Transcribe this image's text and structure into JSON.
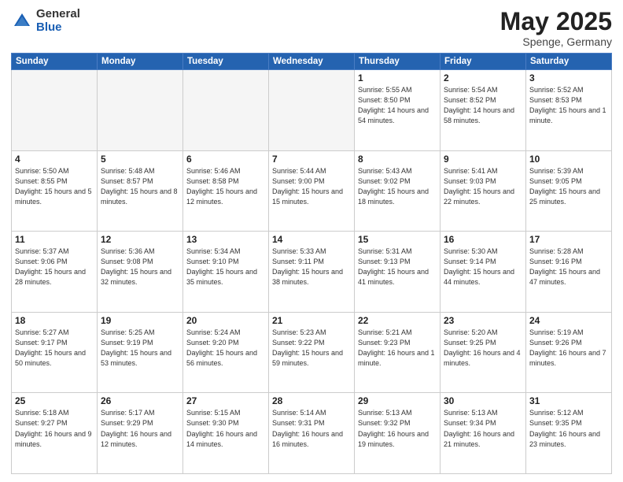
{
  "header": {
    "logo_general": "General",
    "logo_blue": "Blue",
    "title": "May 2025",
    "location": "Spenge, Germany"
  },
  "days_of_week": [
    "Sunday",
    "Monday",
    "Tuesday",
    "Wednesday",
    "Thursday",
    "Friday",
    "Saturday"
  ],
  "weeks": [
    [
      {
        "day": "",
        "info": ""
      },
      {
        "day": "",
        "info": ""
      },
      {
        "day": "",
        "info": ""
      },
      {
        "day": "",
        "info": ""
      },
      {
        "day": "1",
        "info": "Sunrise: 5:55 AM\nSunset: 8:50 PM\nDaylight: 14 hours\nand 54 minutes."
      },
      {
        "day": "2",
        "info": "Sunrise: 5:54 AM\nSunset: 8:52 PM\nDaylight: 14 hours\nand 58 minutes."
      },
      {
        "day": "3",
        "info": "Sunrise: 5:52 AM\nSunset: 8:53 PM\nDaylight: 15 hours\nand 1 minute."
      }
    ],
    [
      {
        "day": "4",
        "info": "Sunrise: 5:50 AM\nSunset: 8:55 PM\nDaylight: 15 hours\nand 5 minutes."
      },
      {
        "day": "5",
        "info": "Sunrise: 5:48 AM\nSunset: 8:57 PM\nDaylight: 15 hours\nand 8 minutes."
      },
      {
        "day": "6",
        "info": "Sunrise: 5:46 AM\nSunset: 8:58 PM\nDaylight: 15 hours\nand 12 minutes."
      },
      {
        "day": "7",
        "info": "Sunrise: 5:44 AM\nSunset: 9:00 PM\nDaylight: 15 hours\nand 15 minutes."
      },
      {
        "day": "8",
        "info": "Sunrise: 5:43 AM\nSunset: 9:02 PM\nDaylight: 15 hours\nand 18 minutes."
      },
      {
        "day": "9",
        "info": "Sunrise: 5:41 AM\nSunset: 9:03 PM\nDaylight: 15 hours\nand 22 minutes."
      },
      {
        "day": "10",
        "info": "Sunrise: 5:39 AM\nSunset: 9:05 PM\nDaylight: 15 hours\nand 25 minutes."
      }
    ],
    [
      {
        "day": "11",
        "info": "Sunrise: 5:37 AM\nSunset: 9:06 PM\nDaylight: 15 hours\nand 28 minutes."
      },
      {
        "day": "12",
        "info": "Sunrise: 5:36 AM\nSunset: 9:08 PM\nDaylight: 15 hours\nand 32 minutes."
      },
      {
        "day": "13",
        "info": "Sunrise: 5:34 AM\nSunset: 9:10 PM\nDaylight: 15 hours\nand 35 minutes."
      },
      {
        "day": "14",
        "info": "Sunrise: 5:33 AM\nSunset: 9:11 PM\nDaylight: 15 hours\nand 38 minutes."
      },
      {
        "day": "15",
        "info": "Sunrise: 5:31 AM\nSunset: 9:13 PM\nDaylight: 15 hours\nand 41 minutes."
      },
      {
        "day": "16",
        "info": "Sunrise: 5:30 AM\nSunset: 9:14 PM\nDaylight: 15 hours\nand 44 minutes."
      },
      {
        "day": "17",
        "info": "Sunrise: 5:28 AM\nSunset: 9:16 PM\nDaylight: 15 hours\nand 47 minutes."
      }
    ],
    [
      {
        "day": "18",
        "info": "Sunrise: 5:27 AM\nSunset: 9:17 PM\nDaylight: 15 hours\nand 50 minutes."
      },
      {
        "day": "19",
        "info": "Sunrise: 5:25 AM\nSunset: 9:19 PM\nDaylight: 15 hours\nand 53 minutes."
      },
      {
        "day": "20",
        "info": "Sunrise: 5:24 AM\nSunset: 9:20 PM\nDaylight: 15 hours\nand 56 minutes."
      },
      {
        "day": "21",
        "info": "Sunrise: 5:23 AM\nSunset: 9:22 PM\nDaylight: 15 hours\nand 59 minutes."
      },
      {
        "day": "22",
        "info": "Sunrise: 5:21 AM\nSunset: 9:23 PM\nDaylight: 16 hours\nand 1 minute."
      },
      {
        "day": "23",
        "info": "Sunrise: 5:20 AM\nSunset: 9:25 PM\nDaylight: 16 hours\nand 4 minutes."
      },
      {
        "day": "24",
        "info": "Sunrise: 5:19 AM\nSunset: 9:26 PM\nDaylight: 16 hours\nand 7 minutes."
      }
    ],
    [
      {
        "day": "25",
        "info": "Sunrise: 5:18 AM\nSunset: 9:27 PM\nDaylight: 16 hours\nand 9 minutes."
      },
      {
        "day": "26",
        "info": "Sunrise: 5:17 AM\nSunset: 9:29 PM\nDaylight: 16 hours\nand 12 minutes."
      },
      {
        "day": "27",
        "info": "Sunrise: 5:15 AM\nSunset: 9:30 PM\nDaylight: 16 hours\nand 14 minutes."
      },
      {
        "day": "28",
        "info": "Sunrise: 5:14 AM\nSunset: 9:31 PM\nDaylight: 16 hours\nand 16 minutes."
      },
      {
        "day": "29",
        "info": "Sunrise: 5:13 AM\nSunset: 9:32 PM\nDaylight: 16 hours\nand 19 minutes."
      },
      {
        "day": "30",
        "info": "Sunrise: 5:13 AM\nSunset: 9:34 PM\nDaylight: 16 hours\nand 21 minutes."
      },
      {
        "day": "31",
        "info": "Sunrise: 5:12 AM\nSunset: 9:35 PM\nDaylight: 16 hours\nand 23 minutes."
      }
    ]
  ]
}
